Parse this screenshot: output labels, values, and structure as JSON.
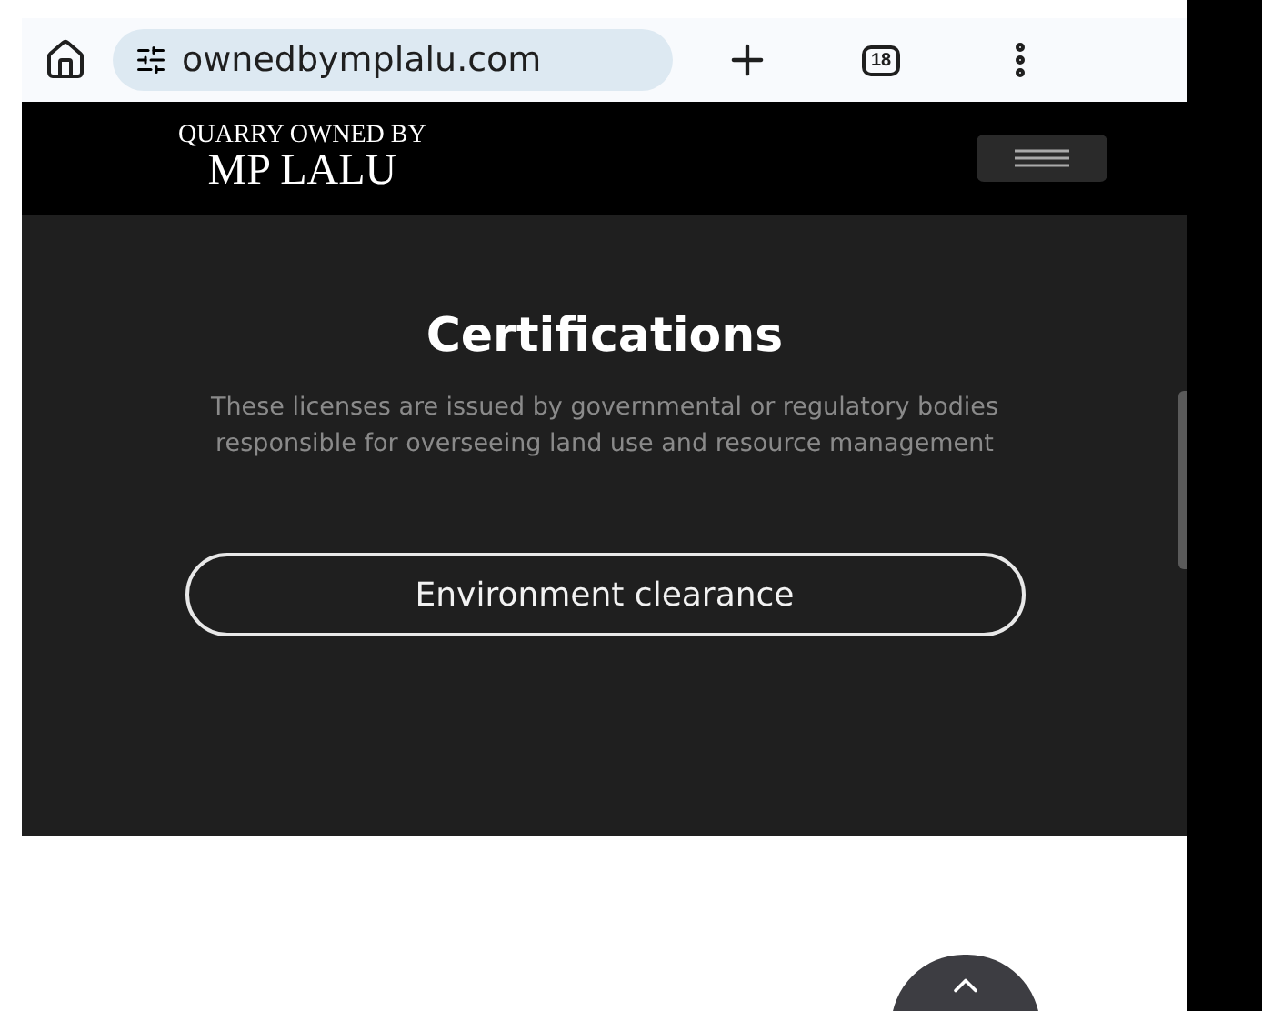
{
  "browser": {
    "url": "ownedbymplalu.com",
    "tab_count": "18"
  },
  "header": {
    "logo_top": "QUARRY OWNED BY",
    "logo_main": "MP LALU"
  },
  "section": {
    "title": "Certifications",
    "description": "These licenses are issued by governmental or regulatory bodies responsible for overseeing land use and resource management",
    "buttons": [
      "Environment clearance"
    ]
  }
}
